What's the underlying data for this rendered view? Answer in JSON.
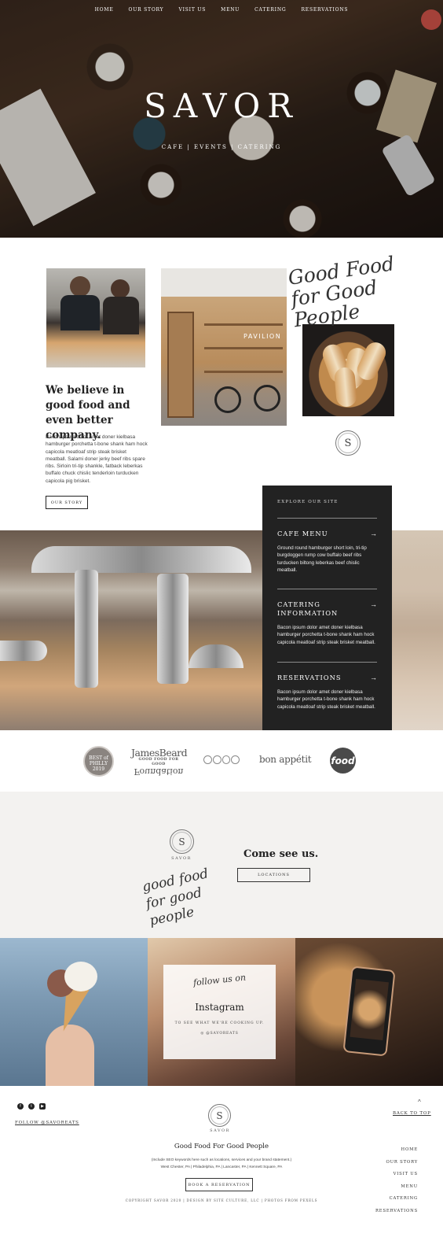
{
  "nav": {
    "items": [
      "HOME",
      "OUR STORY",
      "VISIT US",
      "MENU",
      "CATERING",
      "RESERVATIONS"
    ]
  },
  "hero": {
    "title": "SAVOR",
    "subtitle": "CAFE | EVENTS | CATERING"
  },
  "about": {
    "script_heading": "Good Food for Good People",
    "photo_label": "PAVILION",
    "heading": "We believe in good food and even better company.",
    "body": "Bacon ipsum dolor amet doner kielbasa hamburger porchetta t-bone shank ham hock capicola meatloaf strip steak brisket meatball. Salami doner jerky beef ribs spare ribs. Sirloin tri-tip shankle, fatback leberkas buffalo chuck chislic tenderloin turducken capicola pig brisket.",
    "button": "OUR STORY",
    "logo_letter": "S"
  },
  "explore": {
    "title": "EXPLORE OUR SITE",
    "arrow_icon": "arrow-right-icon",
    "items": [
      {
        "label": "CAFE MENU",
        "desc": "Ground round hamburger short loin, tri-tip burgdoggen rump cow buffalo beef ribs turducken biltong leberkas beef chislic meatball."
      },
      {
        "label": "CATERING INFORMATION",
        "desc": "Bacon ipsum dolor amet doner kielbasa hamburger porchetta t-bone shank ham hock capicola meatloaf strip steak brisket meatball."
      },
      {
        "label": "RESERVATIONS",
        "desc": "Bacon ipsum dolor amet doner kielbasa hamburger porchetta t-bone shank ham hock capicola meatloaf strip steak brisket meatball."
      }
    ]
  },
  "logos": {
    "philly": "BEST of PHILLY 2019",
    "jb_name": "JamesBeard",
    "jb_tag": "GOOD FOOD FOR GOOD",
    "jb_foundation": "Foundation",
    "bon": "bon appétit",
    "food": "food"
  },
  "visit": {
    "logo_letter": "S",
    "brand": "SAVOR",
    "script": "good food for good people",
    "heading": "Come see us.",
    "button": "LOCATIONS"
  },
  "instagram": {
    "script": "follow us on",
    "title": "Instagram",
    "subtitle": "TO SEE WHAT WE'RE COOKING UP.",
    "handle": "@SAVOREATS"
  },
  "footer": {
    "social_icons": [
      "facebook-icon",
      "twitter-icon",
      "youtube-icon"
    ],
    "follow": "FOLLOW @SAVOREATS",
    "logo_letter": "S",
    "brand": "SAVOR",
    "tagline": "Good Food For Good People",
    "seo": "(Include SEO keywords here such as locations, services and your brand statement.)",
    "cities": "West Chester, PA | Philadelphia, PA | Lancaster, PA | Kennett Square, PA",
    "book_button": "BOOK A RESERVATION",
    "copyright": "COPYRIGHT SAVOR 2020 | DESIGN BY SITE CULTURE, LLC | PHOTOS FROM PEXELS",
    "back_to_top": "BACK TO TOP",
    "nav": [
      "HOME",
      "OUR STORY",
      "VISIT US",
      "MENU",
      "CATERING",
      "RESERVATIONS"
    ]
  }
}
